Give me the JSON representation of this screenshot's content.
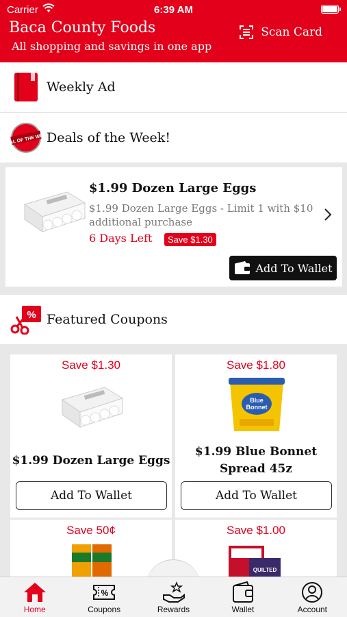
{
  "status": {
    "carrier": "Carrier",
    "time": "6:39 AM"
  },
  "header": {
    "title": "Baca County Foods",
    "subtitle": "All shopping and savings in one app",
    "scan_card": "Scan Card"
  },
  "sections": {
    "weekly_ad": "Weekly Ad",
    "deals_of_week": "Deals of the Week!",
    "featured_coupons": "Featured Coupons"
  },
  "deal": {
    "title": "$1.99 Dozen Large Eggs",
    "description": "$1.99 Dozen Large Eggs  - Limit 1 with $10 additional purchase",
    "days_left": "6 Days Left",
    "save": "Save $1.30",
    "button": "Add To Wallet"
  },
  "coupons": [
    {
      "save": "Save $1.30",
      "name": "$1.99 Dozen Large Eggs",
      "button": "Add To Wallet"
    },
    {
      "save": "Save $1.80",
      "name": "$1.99 Blue Bonnet Spread 45z",
      "button": "Add To Wallet"
    },
    {
      "save": "Save 50¢"
    },
    {
      "save": "Save $1.00"
    }
  ],
  "tabs": [
    {
      "label": "Home",
      "icon": "home-icon",
      "active": true
    },
    {
      "label": "Coupons",
      "icon": "coupon-icon"
    },
    {
      "label": "Rewards",
      "icon": "rewards-icon"
    },
    {
      "label": "Wallet",
      "icon": "wallet-icon"
    },
    {
      "label": "Account",
      "icon": "account-icon"
    }
  ],
  "colors": {
    "brand": "#e3001b",
    "button_dark": "#111111"
  },
  "deal_badge_text": "DEAL OF THE WEEK"
}
